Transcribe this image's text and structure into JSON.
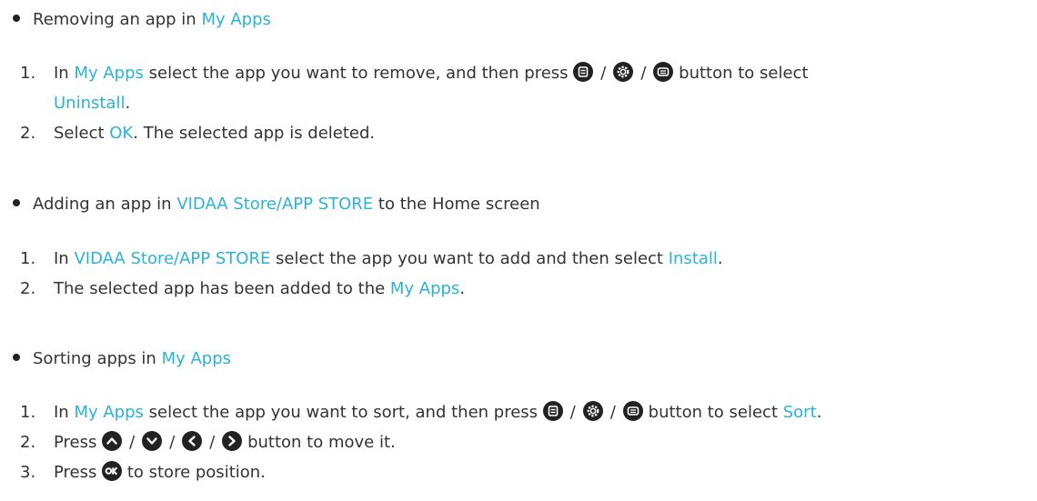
{
  "sections": [
    {
      "heading_text": "Removing an app in ",
      "heading_link": "My Apps",
      "steps": [
        {
          "number": "1.",
          "text_a": "In ",
          "link_a": "My Apps",
          "text_b": " select the app you want to remove, and then press ",
          "icons": [
            "menu-icon",
            "settings-icon",
            "menu-icon"
          ],
          "separator": "/",
          "text_c": " button to select",
          "continuation_link": "Uninstall",
          "continuation_text": "."
        },
        {
          "number": "2.",
          "text_a": "Select ",
          "link_a": "OK",
          "text_b": ". The selected app is deleted."
        }
      ]
    },
    {
      "heading_text_a": "Adding an app in ",
      "heading_link": "VIDAA Store/APP STORE",
      "heading_text_b": " to the Home screen",
      "steps": [
        {
          "number": "1.",
          "text_a": "In ",
          "link_a": "VIDAA Store/APP STORE",
          "text_b": " select the app you want to add and then select ",
          "link_b": "Install",
          "text_c": "."
        },
        {
          "number": "2.",
          "text_a": "The selected app has been added to the ",
          "link_a": "My Apps",
          "text_b": "."
        }
      ]
    },
    {
      "heading_text": "Sorting apps in ",
      "heading_link": "My Apps",
      "steps": [
        {
          "number": "1.",
          "text_a": "In ",
          "link_a": "My Apps",
          "text_b": " select the app you want to sort, and then press ",
          "icons": [
            "menu-icon",
            "settings-icon",
            "menu-icon"
          ],
          "separator": "/",
          "text_c": " button to select ",
          "link_b": "Sort",
          "text_d": "."
        },
        {
          "number": "2.",
          "text_a": "Press ",
          "icons": [
            "arrow-up-icon",
            "arrow-down-icon",
            "arrow-left-icon",
            "arrow-right-icon"
          ],
          "separator": "/",
          "text_b": " button to move it."
        },
        {
          "number": "3.",
          "text_a": "Press ",
          "icons": [
            "ok-icon"
          ],
          "text_b": " to store position."
        }
      ]
    }
  ],
  "colors": {
    "text": "#333333",
    "link": "#2bb3d6",
    "icon_bg": "#222222",
    "icon_fg": "#ffffff"
  }
}
